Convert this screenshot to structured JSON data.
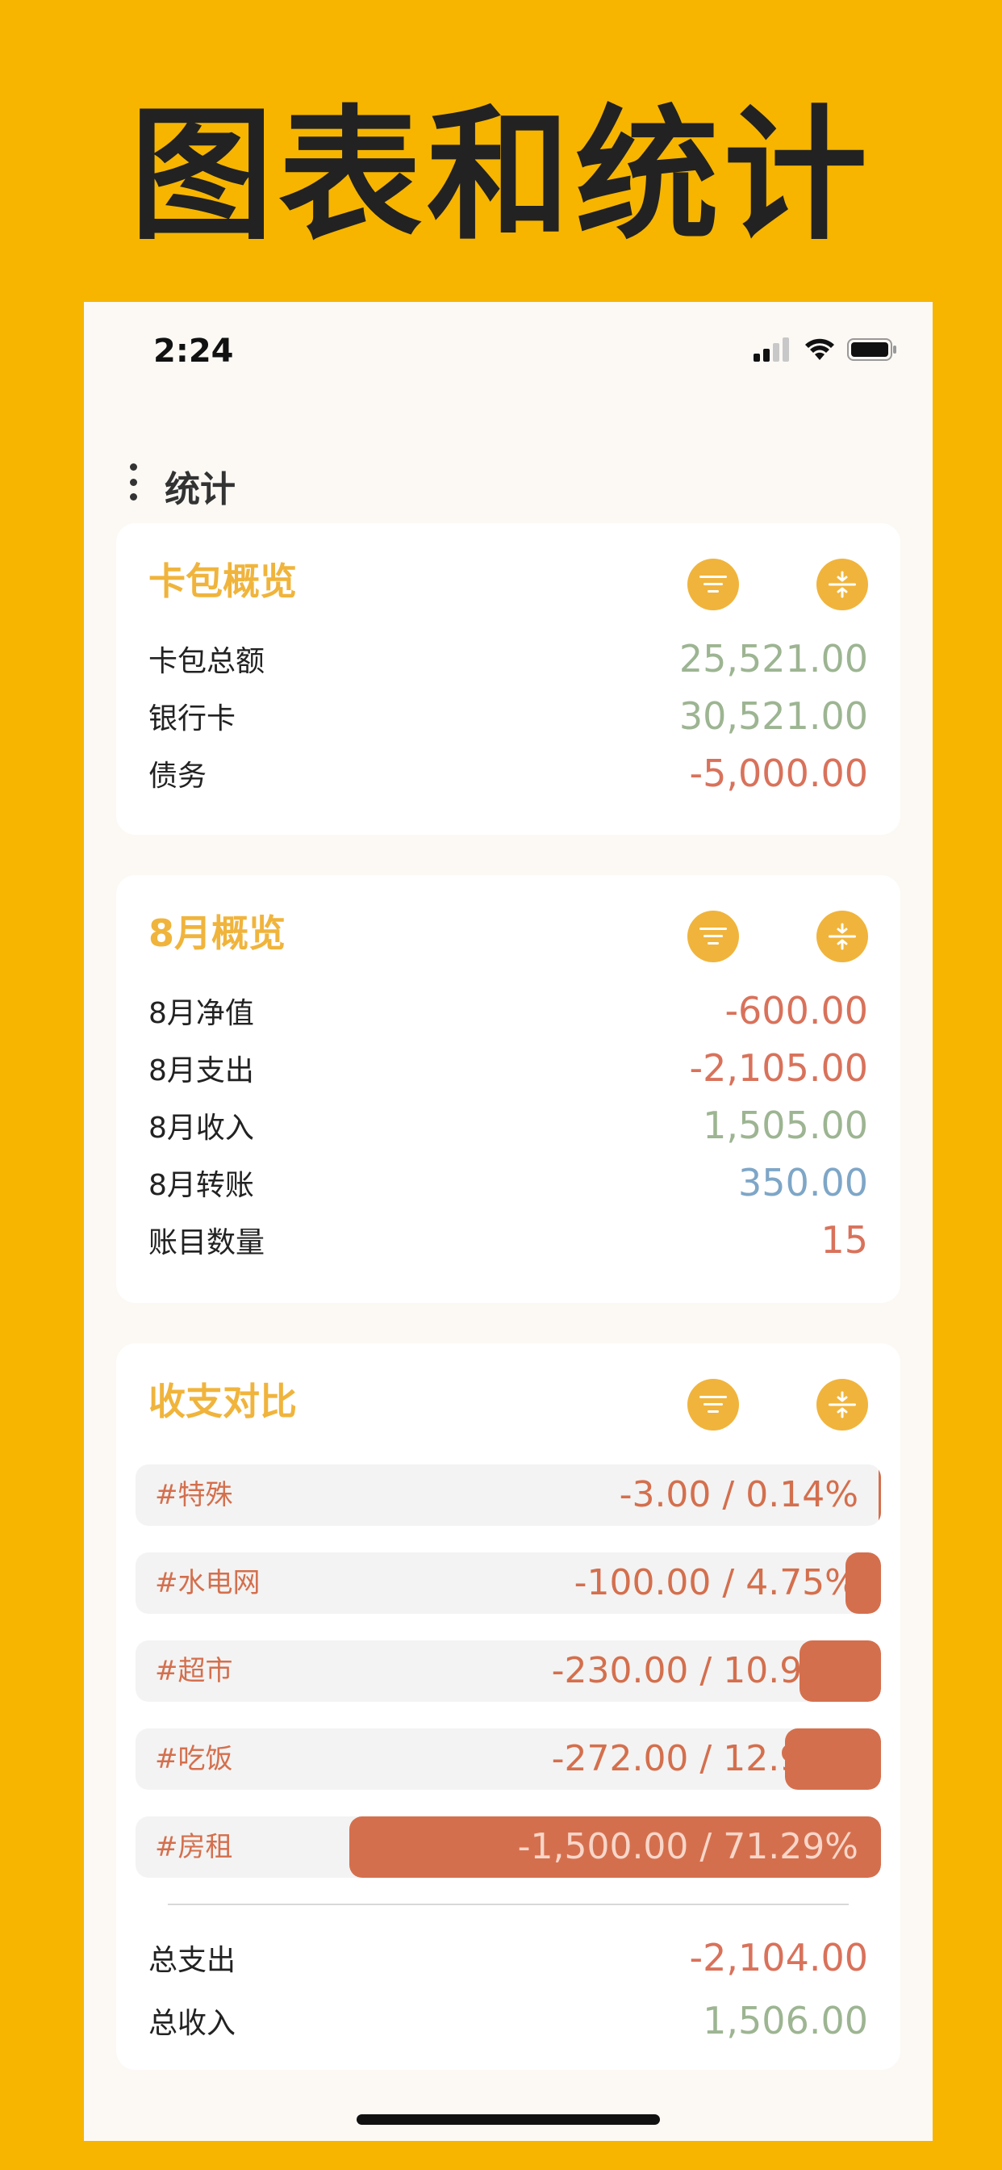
{
  "hero": {
    "title": "图表和统计"
  },
  "status_bar": {
    "time": "2:24"
  },
  "nav": {
    "title": "统计"
  },
  "wallet_card": {
    "title": "卡包概览",
    "rows": [
      {
        "label": "卡包总额",
        "value": "25,521.00",
        "color": "#9DB592"
      },
      {
        "label": "银行卡",
        "value": "30,521.00",
        "color": "#9DB592"
      },
      {
        "label": "债务",
        "value": "-5,000.00",
        "color": "#D9725B"
      }
    ]
  },
  "month_card": {
    "title": "8月概览",
    "rows": [
      {
        "label": "8月净值",
        "value": "-600.00",
        "color": "#D9725B"
      },
      {
        "label": "8月支出",
        "value": "-2,105.00",
        "color": "#D9725B"
      },
      {
        "label": "8月收入",
        "value": "1,505.00",
        "color": "#9DB592"
      },
      {
        "label": "8月转账",
        "value": "350.00",
        "color": "#7EA6C7"
      },
      {
        "label": "账目数量",
        "value": "15",
        "color": "#D9725B"
      }
    ]
  },
  "compare_card": {
    "title": "收支对比",
    "bars": [
      {
        "tag": "#特殊",
        "value": "-3.00 / 0.14%",
        "fraction": 0.0014
      },
      {
        "tag": "#水电网",
        "value": "-100.00 / 4.75%",
        "fraction": 0.0475
      },
      {
        "tag": "#超市",
        "value": "-230.00 / 10.93%",
        "fraction": 0.1093
      },
      {
        "tag": "#吃饭",
        "value": "-272.00 / 12.93%",
        "fraction": 0.1293
      },
      {
        "tag": "#房租",
        "value": "-1,500.00 / 71.29%",
        "fraction": 0.7129
      }
    ],
    "totals": [
      {
        "label": "总支出",
        "value": "-2,104.00",
        "color": "#D9725B"
      },
      {
        "label": "总收入",
        "value": "1,506.00",
        "color": "#9DB592"
      }
    ]
  }
}
